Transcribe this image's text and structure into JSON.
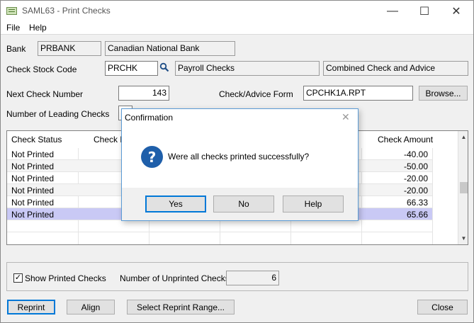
{
  "window": {
    "title": "SAML63 - Print Checks",
    "controls": {
      "minimize": "—",
      "maximize": "☐",
      "close": "✕"
    }
  },
  "menu": [
    "File",
    "Help"
  ],
  "bank": {
    "label": "Bank",
    "code": "PRBANK",
    "name": "Canadian National Bank"
  },
  "check_stock": {
    "label": "Check Stock Code",
    "code": "PRCHK",
    "description": "Payroll Checks",
    "type": "Combined Check and Advice"
  },
  "next_check": {
    "label": "Next Check Number",
    "value": "143"
  },
  "form": {
    "label": "Check/Advice Form",
    "value": "CPCHK1A.RPT",
    "browse_label": "Browse..."
  },
  "leading_checks": {
    "label": "Number of Leading Checks"
  },
  "grid": {
    "headers": {
      "status": "Check Status",
      "number": "Check N",
      "amount": "Check Amount"
    },
    "rows": [
      {
        "status": "Not Printed",
        "amount": "-40.00"
      },
      {
        "status": "Not Printed",
        "amount": "-50.00"
      },
      {
        "status": "Not Printed",
        "amount": "-20.00"
      },
      {
        "status": "Not Printed",
        "amount": "-20.00"
      },
      {
        "status": "Not Printed",
        "amount": "66.33"
      },
      {
        "status": "Not Printed",
        "amount": "65.66"
      }
    ]
  },
  "show_printed": {
    "label": "Show Printed Checks",
    "checked": "✓"
  },
  "unprinted": {
    "label": "Number of Unprinted Checks",
    "value": "6"
  },
  "buttons": {
    "reprint": "Reprint",
    "align": "Align",
    "select_range": "Select Reprint Range...",
    "close": "Close"
  },
  "dialog": {
    "title": "Confirmation",
    "close": "✕",
    "icon_glyph": "?",
    "icon": "question-icon",
    "message": "Were all checks printed successfully?",
    "buttons": {
      "yes": "Yes",
      "no": "No",
      "help": "Help"
    }
  }
}
